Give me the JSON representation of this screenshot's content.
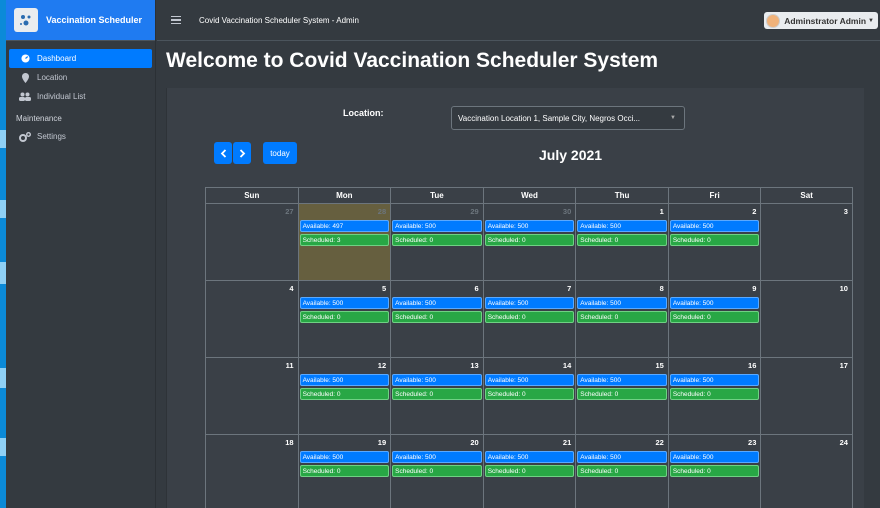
{
  "brand": {
    "name": "Vaccination Scheduler"
  },
  "topbar": {
    "title": "Covid Vaccination Scheduler System - Admin",
    "user": "Adminstrator Admin"
  },
  "sidebar": {
    "items": [
      {
        "label": "Dashboard",
        "icon": "dashboard-icon",
        "active": true
      },
      {
        "label": "Location",
        "icon": "map-marker-icon"
      },
      {
        "label": "Individual List",
        "icon": "users-icon"
      }
    ],
    "header": "Maintenance",
    "items2": [
      {
        "label": "Settings",
        "icon": "gears-icon"
      }
    ]
  },
  "page": {
    "title": "Welcome to Covid Vaccination Scheduler System"
  },
  "filter": {
    "label": "Location:",
    "value": "Vaccination Location 1, Sample City, Negros Occi..."
  },
  "calendar": {
    "today_label": "today",
    "month": "July 2021",
    "weekdays": [
      "Sun",
      "Mon",
      "Tue",
      "Wed",
      "Thu",
      "Fri",
      "Sat"
    ],
    "weeks": [
      [
        {
          "d": "27",
          "muted": true
        },
        {
          "d": "28",
          "muted": true,
          "today": true,
          "avail": "Available: 497",
          "sched": "Scheduled: 3"
        },
        {
          "d": "29",
          "muted": true,
          "avail": "Available: 500",
          "sched": "Scheduled: 0"
        },
        {
          "d": "30",
          "muted": true,
          "avail": "Available: 500",
          "sched": "Scheduled: 0"
        },
        {
          "d": "1",
          "avail": "Available: 500",
          "sched": "Scheduled: 0"
        },
        {
          "d": "2",
          "avail": "Available: 500",
          "sched": "Scheduled: 0"
        },
        {
          "d": "3"
        }
      ],
      [
        {
          "d": "4"
        },
        {
          "d": "5",
          "avail": "Available: 500",
          "sched": "Scheduled: 0"
        },
        {
          "d": "6",
          "avail": "Available: 500",
          "sched": "Scheduled: 0"
        },
        {
          "d": "7",
          "avail": "Available: 500",
          "sched": "Scheduled: 0"
        },
        {
          "d": "8",
          "avail": "Available: 500",
          "sched": "Scheduled: 0"
        },
        {
          "d": "9",
          "avail": "Available: 500",
          "sched": "Scheduled: 0"
        },
        {
          "d": "10"
        }
      ],
      [
        {
          "d": "11"
        },
        {
          "d": "12",
          "avail": "Available: 500",
          "sched": "Scheduled: 0"
        },
        {
          "d": "13",
          "avail": "Available: 500",
          "sched": "Scheduled: 0"
        },
        {
          "d": "14",
          "avail": "Available: 500",
          "sched": "Scheduled: 0"
        },
        {
          "d": "15",
          "avail": "Available: 500",
          "sched": "Scheduled: 0"
        },
        {
          "d": "16",
          "avail": "Available: 500",
          "sched": "Scheduled: 0"
        },
        {
          "d": "17"
        }
      ],
      [
        {
          "d": "18"
        },
        {
          "d": "19",
          "avail": "Available: 500",
          "sched": "Scheduled: 0"
        },
        {
          "d": "20",
          "avail": "Available: 500",
          "sched": "Scheduled: 0"
        },
        {
          "d": "21",
          "avail": "Available: 500",
          "sched": "Scheduled: 0"
        },
        {
          "d": "22",
          "avail": "Available: 500",
          "sched": "Scheduled: 0"
        },
        {
          "d": "23",
          "avail": "Available: 500",
          "sched": "Scheduled: 0"
        },
        {
          "d": "24"
        }
      ]
    ]
  },
  "colors": {
    "accent": "#007bff",
    "success": "#28a745",
    "dark": "#343a40"
  }
}
